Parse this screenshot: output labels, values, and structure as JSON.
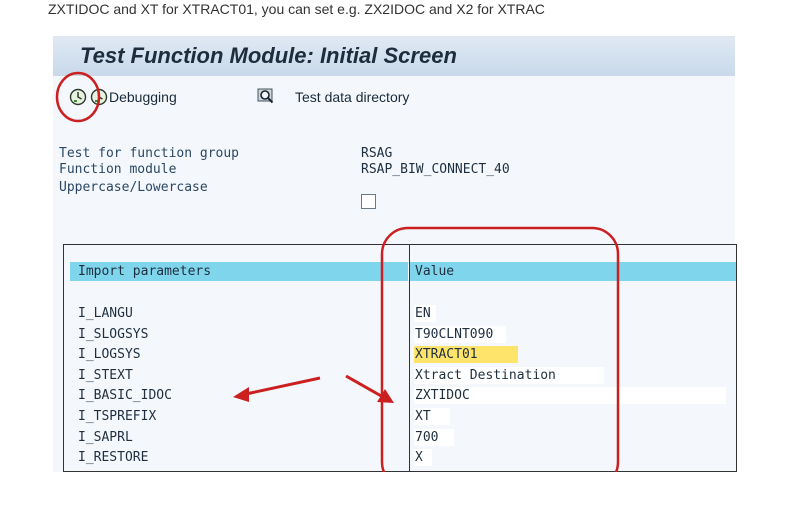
{
  "doc_text": "ZXTIDOC and XT for XTRACT01, you can set e.g. ZX2IDOC and X2 for XTRAC",
  "window": {
    "title": "Test Function Module: Initial Screen"
  },
  "toolbar": {
    "execute_icon": "execute-clock-icon",
    "debugging_icon": "debug-clock-icon",
    "debugging_label": "Debugging",
    "test_data_icon": "magnifier-glass-icon",
    "test_data_label": "Test data directory"
  },
  "header_fields": {
    "function_group_label": "Test for function group",
    "function_group_value": "RSAG",
    "function_module_label": "Function module",
    "function_module_value": "RSAP_BIW_CONNECT_40",
    "case_label": "Uppercase/Lowercase",
    "case_checked": false
  },
  "table": {
    "col_param": "Import parameters",
    "col_value": "Value",
    "rows": [
      {
        "name": "I_LANGU",
        "value": "EN"
      },
      {
        "name": "I_SLOGSYS",
        "value": "T90CLNT090"
      },
      {
        "name": "I_LOGSYS",
        "value": "XTRACT01"
      },
      {
        "name": "I_STEXT",
        "value": "Xtract Destination"
      },
      {
        "name": "I_BASIC_IDOC",
        "value": "ZXTIDOC"
      },
      {
        "name": "I_TSPREFIX",
        "value": "XT"
      },
      {
        "name": "I_SAPRL",
        "value": "700"
      },
      {
        "name": "I_RESTORE",
        "value": "X"
      }
    ]
  },
  "colors": {
    "header_cyan": "#7fd5ec",
    "highlight_yellow": "#ffe46b",
    "annotation_red": "#cc2020",
    "label_blue": "#2c4763"
  }
}
